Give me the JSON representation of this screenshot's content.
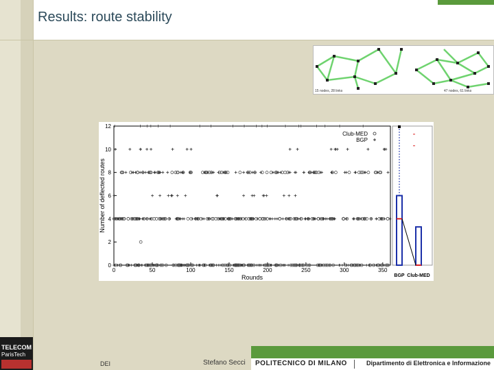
{
  "slide": {
    "title": "Results: route stability",
    "footer_left": "DEI",
    "footer_author": "Stefano Secci",
    "footer_institution": "POLITECNICO DI MILANO",
    "footer_department": "Dipartimento di Elettronica e Informazione",
    "logo_line1": "TELECOM",
    "logo_line2": "ParisTech",
    "colors": {
      "background": "#ddd9c3",
      "title": "#2c4a5a",
      "accent_green": "#5a9a3c"
    }
  },
  "thumbnail": {
    "description_icon": "network-topology-image",
    "left_caption": "15 nodes, 28 links",
    "right_caption": "47 nodes, 61 links"
  },
  "chart_data": {
    "type": "scatter",
    "xlabel": "Rounds",
    "ylabel": "Number of deflected routes",
    "xlim": [
      0,
      360
    ],
    "ylim": [
      0,
      12
    ],
    "xticks": [
      0,
      50,
      100,
      150,
      200,
      250,
      300,
      350
    ],
    "yticks": [
      0,
      2,
      4,
      6,
      8,
      10,
      12
    ],
    "legend": {
      "placement": "top-right",
      "entries": [
        "Club-MED",
        "BGP"
      ]
    },
    "series": [
      {
        "name": "Club-MED",
        "marker": "circle",
        "y_levels": [
          0,
          2,
          4,
          8
        ],
        "x_ranges": [
          [
            0,
            360
          ],
          [
            35,
            35
          ],
          [
            0,
            360
          ],
          [
            0,
            360
          ]
        ]
      },
      {
        "name": "BGP",
        "marker": "plus",
        "y_levels": [
          0,
          4,
          6,
          8,
          10,
          12
        ],
        "x_ranges": [
          [
            0,
            360
          ],
          [
            0,
            360
          ],
          [
            0,
            240
          ],
          [
            0,
            360
          ],
          [
            0,
            360
          ],
          [
            0,
            360
          ]
        ]
      }
    ],
    "boxplot": {
      "categories": [
        "BGP",
        "Club-MED"
      ],
      "ylim": [
        0,
        12
      ],
      "boxes": [
        {
          "name": "BGP",
          "q1": 0,
          "median": 4,
          "q3": 6,
          "whisker_low": 0,
          "whisker_high": 12
        },
        {
          "name": "Club-MED",
          "q1": 0,
          "median": 0,
          "q3": 3.3,
          "whisker_low": 0,
          "whisker_high": 3.3
        }
      ]
    }
  }
}
